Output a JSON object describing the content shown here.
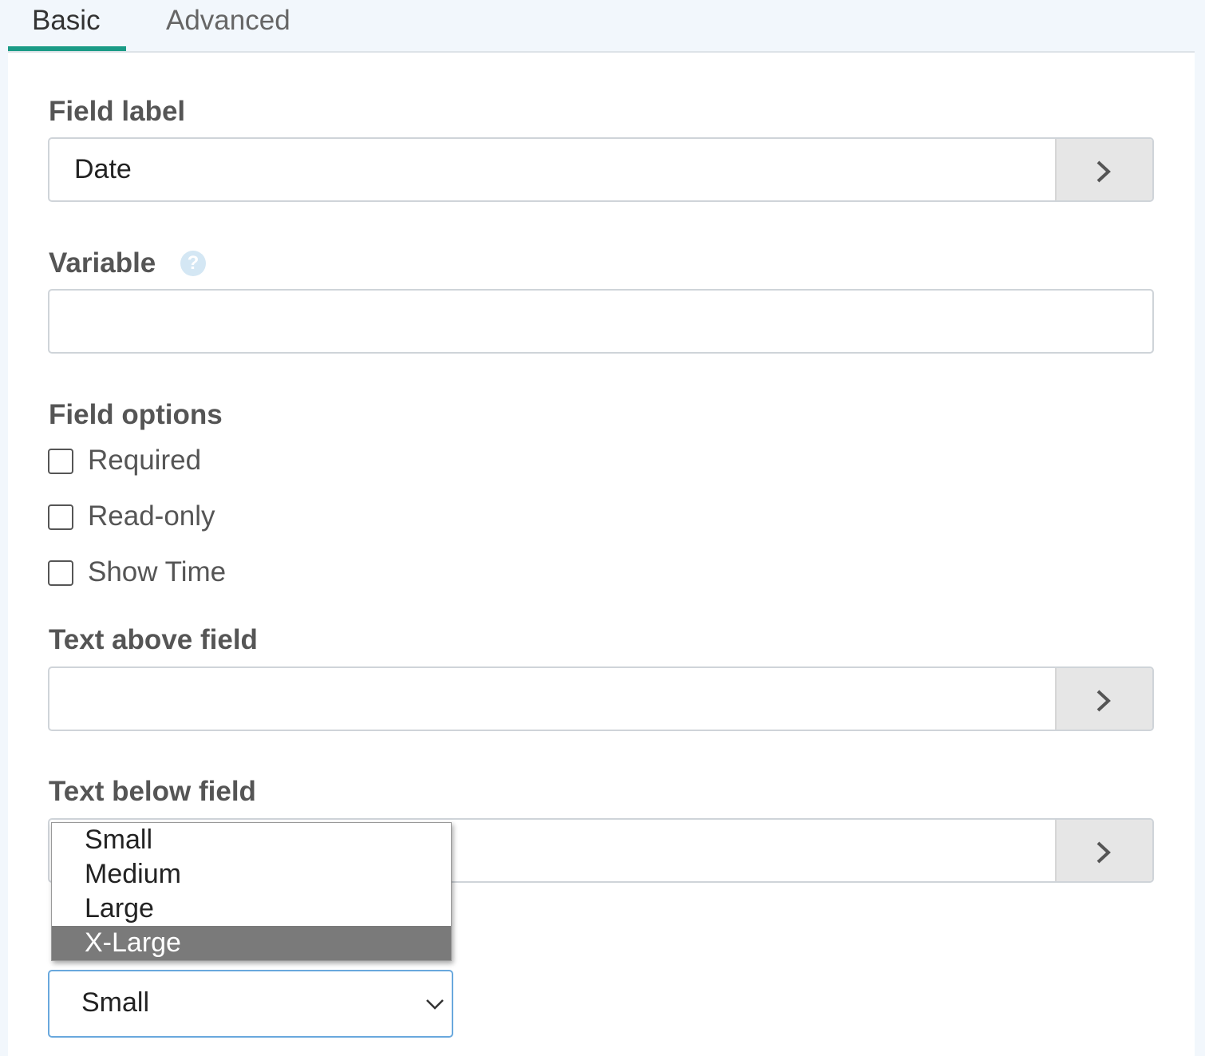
{
  "tabs": [
    {
      "label": "Basic",
      "active": true
    },
    {
      "label": "Advanced",
      "active": false
    }
  ],
  "accent_color": "#1a9b86",
  "fields": {
    "field_label": {
      "label": "Field label",
      "value": "Date"
    },
    "variable": {
      "label": "Variable",
      "value": "",
      "help_icon": "question-circle-icon"
    },
    "field_options": {
      "label": "Field options",
      "options": [
        {
          "label": "Required",
          "checked": false
        },
        {
          "label": "Read-only",
          "checked": false
        },
        {
          "label": "Show Time",
          "checked": false
        }
      ]
    },
    "text_above": {
      "label": "Text above field",
      "value": ""
    },
    "text_below": {
      "label": "Text below field",
      "value": ""
    }
  },
  "size_select": {
    "value": "Small",
    "options": [
      "Small",
      "Medium",
      "Large",
      "X-Large"
    ],
    "highlighted": "X-Large"
  }
}
